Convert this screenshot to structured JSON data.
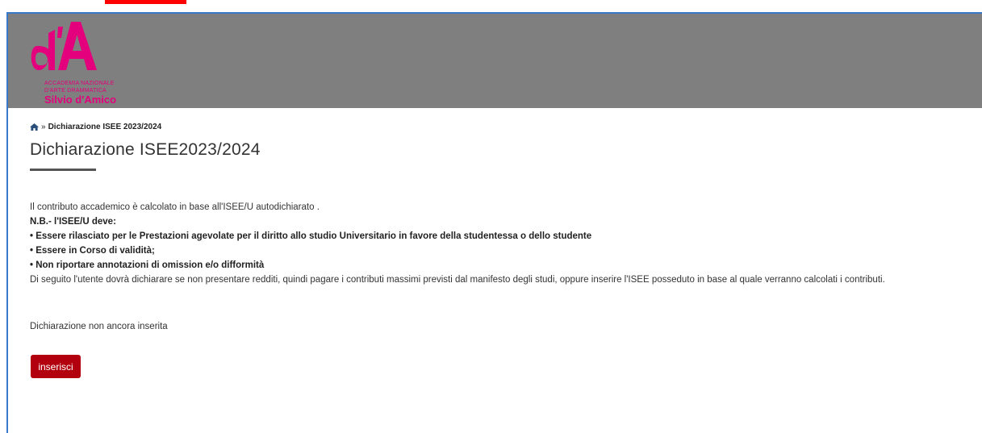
{
  "colors": {
    "accent": "#b3000f",
    "brand": "#e4007c",
    "header_bg": "#7f7f7f"
  },
  "logo": {
    "mark_text": "d'A",
    "line1": "ACCADEMIA NAZIONALE",
    "line2": "D'ARTE DRAMMATICA",
    "name": "Silvio d'Amico"
  },
  "breadcrumb": {
    "home_icon": "home-icon",
    "separator": "»",
    "current": "Dichiarazione ISEE 2023/2024"
  },
  "page_title": "Dichiarazione ISEE2023/2024",
  "intro": {
    "line1": "Il contributo accademico è calcolato in base all'ISEE/U autodichiarato .",
    "nb": "N.B.- l'ISEE/U deve:",
    "items": [
      "• Essere rilasciato per le Prestazioni agevolate per il diritto allo studio Universitario in favore della studentessa o dello studente",
      "• Essere in Corso di validità;",
      "• Non riportare annotazioni di omission e/o difformità"
    ],
    "note": "Di seguito l'utente dovrà dichiarare se non presentare redditi, quindi pagare i contributi massimi previsti dal manifesto degli studi, oppure inserire l'ISEE posseduto in base al quale verranno calcolati i contributi."
  },
  "status_text": "Dichiarazione non ancora inserita",
  "insert_button": "inserisci"
}
